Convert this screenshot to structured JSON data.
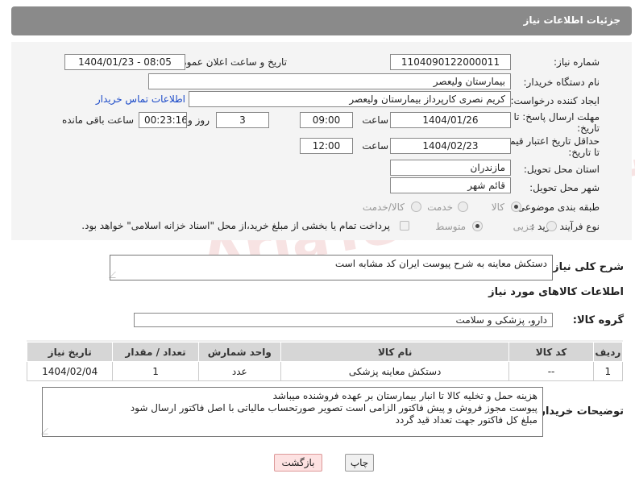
{
  "header": {
    "title": "جزئیات اطلاعات نیاز"
  },
  "watermark": {
    "text": "AriaTender.net"
  },
  "fields": {
    "need_number": {
      "label": "شماره نیاز:",
      "value": "1104090122000011"
    },
    "announce_datetime": {
      "label": "تاریخ و ساعت اعلان عمومی:",
      "value": "1404/01/23 - 08:05"
    },
    "buyer_org": {
      "label": "نام دستگاه خریدار:",
      "value": "بیمارستان ولیعصر"
    },
    "requester": {
      "label": "ایجاد کننده درخواست:",
      "value": "کریم نصری کارپرداز بیمارستان ولیعصر",
      "contact_link": "اطلاعات تماس خریدار"
    },
    "reply_deadline": {
      "label_line1": "مهلت ارسال پاسخ: تا",
      "label_line2": "تاریخ:",
      "date": "1404/01/26",
      "time_label": "ساعت",
      "time": "09:00",
      "days": "3",
      "days_label": "روز و",
      "remaining": "00:23:16",
      "remaining_label": "ساعت باقی مانده"
    },
    "price_validity": {
      "label_line1": "حداقل تاریخ اعتبار قیمت:",
      "label_line2": "تا تاریخ:",
      "date": "1404/02/23",
      "time_label": "ساعت",
      "time": "12:00"
    },
    "delivery_province": {
      "label": "استان محل تحویل:",
      "value": "مازندران"
    },
    "delivery_city": {
      "label": "شهر محل تحویل:",
      "value": "قائم شهر"
    },
    "category": {
      "label": "طبقه بندی موضوعی:",
      "options": [
        "کالا",
        "خدمت",
        "کالا/خدمت"
      ],
      "selected": "کالا"
    },
    "purchase_process": {
      "label": "نوع فرآیند خرید :",
      "options": [
        "جزیی",
        "متوسط"
      ],
      "selected": "متوسط",
      "payment_note": "پرداخت تمام یا بخشی از مبلغ خرید،از محل \"اسناد خزانه اسلامی\" خواهد بود."
    }
  },
  "description": {
    "label": "شرح کلی نیاز:",
    "value": "دستکش معاینه به شرح پیوست     ایران کد مشابه است"
  },
  "goods_section": {
    "title": "اطلاعات کالاهای مورد نیاز",
    "group_label": "گروه کالا:",
    "group_value": "دارو، پزشکی و سلامت"
  },
  "table": {
    "columns": [
      "ردیف",
      "کد کالا",
      "نام کالا",
      "واحد شمارش",
      "تعداد / مقدار",
      "تاریخ نیاز"
    ],
    "rows": [
      [
        "1",
        "--",
        "دستکش معاینه پزشکی",
        "عدد",
        "1",
        "1404/02/04"
      ]
    ]
  },
  "buyer_notes": {
    "label": "توضیحات خریدار:",
    "lines": [
      "هزینه حمل و تخلیه کالا تا انبار بیمارستان بر عهده فروشنده میباشد",
      "پیوست مجوز فروش و پیش فاکتور الزامی است  تصویر صورتحساب مالیاتی با اصل فاکتور ارسال شود",
      "مبلغ کل فاکتور جهت تعداد قید گردد"
    ]
  },
  "buttons": {
    "print": "چاپ",
    "back": "بازگشت"
  }
}
